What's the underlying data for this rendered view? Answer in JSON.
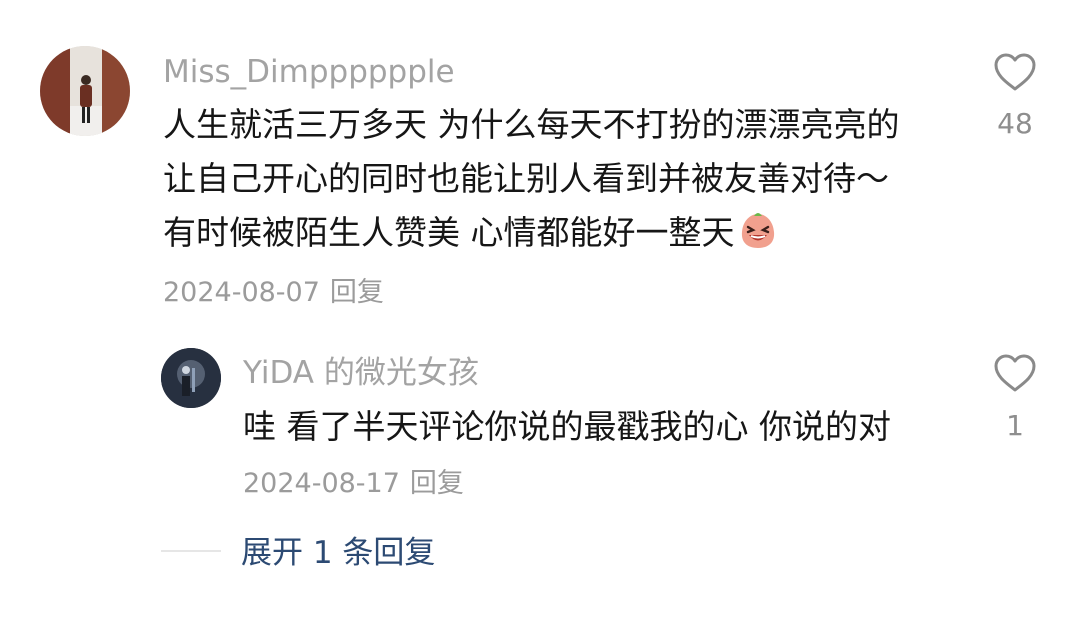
{
  "comment": {
    "username": "Miss_Dimpppppple",
    "lines": [
      "人生就活三万多天 为什么每天不打扮的漂漂亮亮的",
      "让自己开心的同时也能让别人看到并被友善对待～",
      "有时候被陌生人赞美 心情都能好一整天"
    ],
    "emoji": "laughing-face-emoji",
    "date": "2024-08-07",
    "reply_label": "回复",
    "like_count": "48"
  },
  "reply": {
    "username": "YiDA 的微光女孩",
    "text": "哇 看了半天评论你说的最戳我的心 你说的对",
    "date": "2024-08-17",
    "reply_label": "回复",
    "like_count": "1"
  },
  "expand_label": "展开 1 条回复",
  "colors": {
    "username": "#a3a3a3",
    "text": "#161616",
    "meta": "#9b9b9b",
    "link": "#2c4a73",
    "heart_outline": "#8a8a8a"
  }
}
